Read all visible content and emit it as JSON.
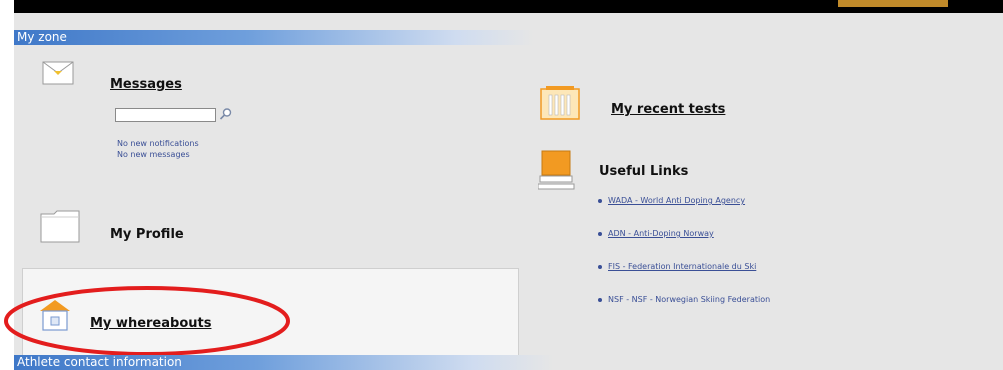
{
  "zone_header": {
    "title": "My zone"
  },
  "messages": {
    "title": "Messages",
    "search_placeholder": "",
    "notifications_text": "No new notifications",
    "messages_text": "No new messages"
  },
  "profile": {
    "title": "My Profile"
  },
  "whereabouts": {
    "title": "My whereabouts"
  },
  "recent_tests": {
    "title": "My recent tests"
  },
  "useful_links": {
    "title": "Useful Links",
    "links": [
      "WADA - World Anti Doping Agency",
      "ADN - Anti-Doping Norway",
      "FIS - Federation Internationale du Ski",
      "NSF - NSF - Norwegian Skiing Federation"
    ]
  },
  "bottom_header": {
    "title": "Athlete contact information"
  },
  "colors": {
    "header_blue": "#3f78c8",
    "panel_bg": "#e6e6e6",
    "link_color": "#3a4f96",
    "highlight_red": "#e31d1d",
    "icon_orange": "#f29a22"
  },
  "icons": {
    "messages": "envelope-icon",
    "search": "search-icon",
    "profile": "folder-icon",
    "whereabouts": "house-icon",
    "recent_tests": "test-tubes-icon",
    "useful_links": "computer-icon"
  }
}
